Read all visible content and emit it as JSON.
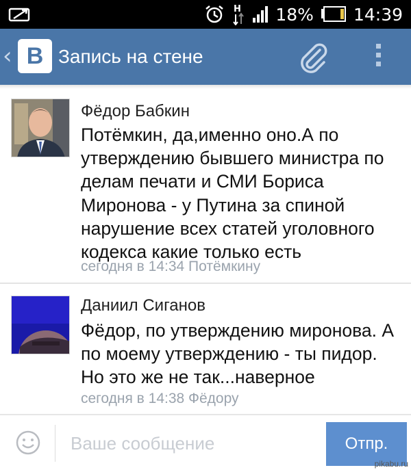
{
  "status_bar": {
    "battery": "18%",
    "time": "14:39",
    "network_letter": "H"
  },
  "header": {
    "back": "‹",
    "logo": "B",
    "title": "Запись на стене"
  },
  "comments": [
    {
      "author": "Фёдор Бабкин",
      "lines": [
        "Потёмкин, да,именно оно.А по",
        "утверждению бывшего министра по",
        "делам печати и СМИ Бориса",
        "Миронова - у Путина за спиной",
        "нарушение всех статей уголовного",
        "кодекса какие только есть"
      ],
      "meta": "сегодня в 14:34 Потёмкину"
    },
    {
      "author": "Даниил Сиганов",
      "lines": [
        "Фёдор, по утверждению миронова. А",
        "по моему утверждению - ты пидор.",
        "Но это же не так...наверное"
      ],
      "meta": "сегодня в 14:38 Фёдору"
    }
  ],
  "composer": {
    "placeholder": "Ваше сообщение",
    "send_label": "Отпр."
  },
  "watermark": "pikabu.ru",
  "colors": {
    "header": "#4a76a8",
    "send_button": "#5d8fcf",
    "meta_text": "#9aa3ad"
  }
}
